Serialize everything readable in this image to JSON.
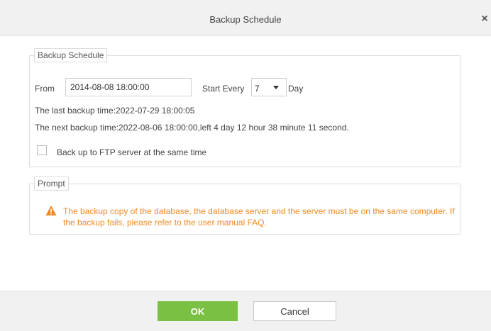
{
  "dialog": {
    "title": "Backup Schedule",
    "close_glyph": "×"
  },
  "schedule": {
    "legend": "Backup Schedule",
    "from_label": "From",
    "from_value": "2014-08-08 18:00:00",
    "start_every_label": "Start Every",
    "interval_value": "7",
    "unit_label": "Day",
    "last_backup": "The last backup time:2022-07-29 18:00:05",
    "next_backup": "The next backup time:2022-08-06 18:00:00,left 4 day 12 hour 38 minute 11 second.",
    "ftp_checked": false,
    "ftp_label": "Back up to FTP server at the same time"
  },
  "prompt": {
    "legend": "Prompt",
    "icon": "warning-icon",
    "text": "The backup copy of the database, the database server and the server must be on the same computer. If the backup fails, please refer to the user manual FAQ.",
    "color": "#f08a24"
  },
  "buttons": {
    "ok_label": "OK",
    "cancel_label": "Cancel",
    "ok_color": "#7ac143"
  }
}
